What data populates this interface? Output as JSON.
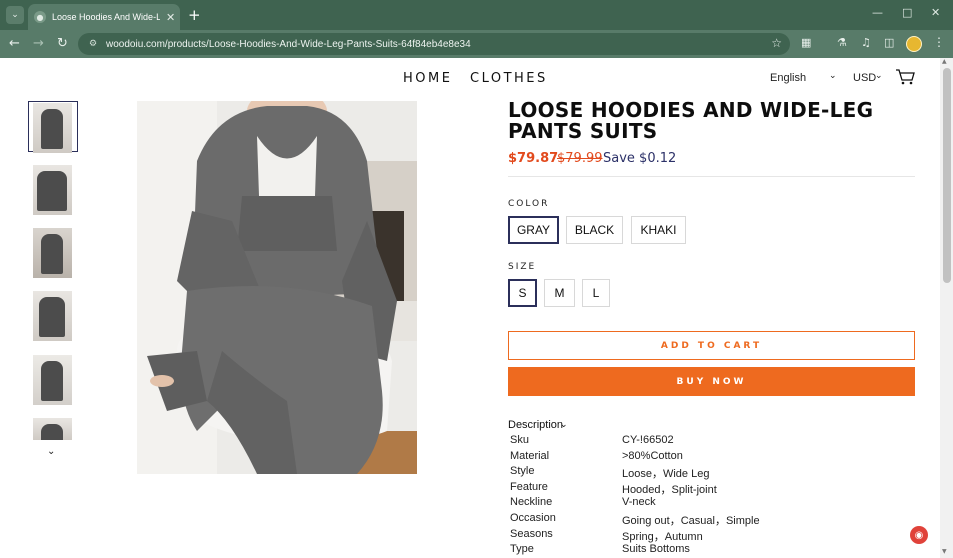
{
  "browser": {
    "tab_title": "Loose Hoodies And Wide-Leg",
    "url": "woodoiu.com/products/Loose-Hoodies-And-Wide-Leg-Pants-Suits-64f84eb4e8e34",
    "icons": {
      "tab_menu": "chevron-down-icon",
      "new_tab": "plus-icon",
      "back": "arrow-left-icon",
      "forward": "arrow-right-icon",
      "reload": "reload-icon",
      "bookmark": "star-icon",
      "extensions": "puzzle-icon",
      "labs": "flask-icon",
      "media": "media-controls-icon",
      "side_panel": "side-panel-icon",
      "menu": "kebab-menu-icon"
    },
    "colors": {
      "frame": "#3f6350",
      "toolbar": "#587b69"
    }
  },
  "site": {
    "nav": {
      "home": "HOME",
      "clothes": "CLOTHES"
    },
    "language": "English",
    "currency": "USD",
    "icons": {
      "cart": "cart-icon",
      "thumbs_down": "chevron-down-icon"
    }
  },
  "product": {
    "title": "LOOSE HOODIES AND WIDE-LEG PANTS SUITS",
    "price": "$79.87",
    "compare_price": "$79.99",
    "save": "Save $0.12",
    "color_label": "COLOR",
    "colors": [
      "GRAY",
      "BLACK",
      "KHAKI"
    ],
    "selected_color": "GRAY",
    "size_label": "SIZE",
    "sizes": [
      "S",
      "M",
      "L"
    ],
    "selected_size": "S",
    "add_to_cart": "ADD TO CART",
    "buy_now": "BUY NOW",
    "description_label": "Description",
    "specs": [
      {
        "key": "Sku",
        "value": "CY-!66502"
      },
      {
        "key": "Material",
        "value": ">80%Cotton"
      },
      {
        "key": "Style",
        "value": "Loose，Wide Leg"
      },
      {
        "key": "Feature",
        "value": "Hooded，Split-joint"
      },
      {
        "key": "Neckline",
        "value": "V-neck"
      },
      {
        "key": "Occasion",
        "value": "Going out，Casual，Simple"
      },
      {
        "key": "Seasons",
        "value": "Spring，Autumn"
      },
      {
        "key": "Type",
        "value": "Suits Bottoms"
      }
    ],
    "accent_color": "#ee6a1f",
    "price_color": "#e24a1d"
  }
}
